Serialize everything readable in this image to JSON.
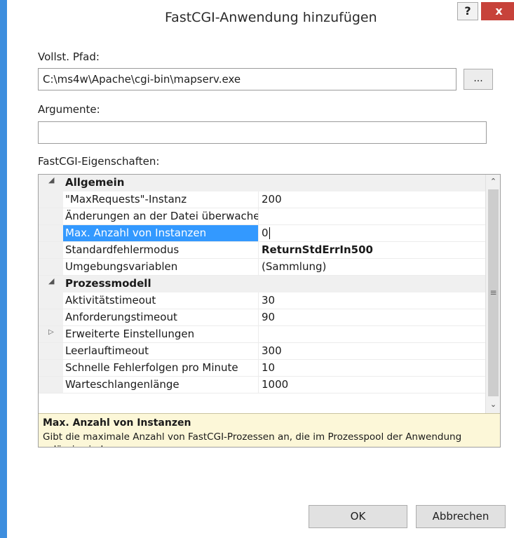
{
  "window": {
    "title": "FastCGI-Anwendung hinzufügen",
    "help_label": "?",
    "close_label": "x"
  },
  "full_path": {
    "label": "Vollst. Pfad:",
    "value": "C:\\ms4w\\Apache\\cgi-bin\\mapserv.exe",
    "browse_label": "..."
  },
  "arguments": {
    "label": "Argumente:",
    "value": ""
  },
  "properties": {
    "label": "FastCGI-Eigenschaften:",
    "categories": [
      {
        "name": "Allgemein",
        "expanded": true,
        "rows": [
          {
            "name": "\"MaxRequests\"-Instanz",
            "value": "200"
          },
          {
            "name": "Änderungen an der Datei überwache",
            "value": ""
          },
          {
            "name": "Max. Anzahl von Instanzen",
            "value": "0",
            "selected": true
          },
          {
            "name": "Standardfehlermodus",
            "value": "ReturnStdErrIn500"
          },
          {
            "name": "Umgebungsvariablen",
            "value": "(Sammlung)"
          }
        ]
      },
      {
        "name": "Prozessmodell",
        "expanded": true,
        "rows": [
          {
            "name": "Aktivitätstimeout",
            "value": "30"
          },
          {
            "name": "Anforderungstimeout",
            "value": "90"
          },
          {
            "name": "Erweiterte Einstellungen",
            "value": "",
            "collapsed": true
          },
          {
            "name": "Leerlauftimeout",
            "value": "300"
          },
          {
            "name": "Schnelle Fehlerfolgen pro Minute",
            "value": "10"
          },
          {
            "name": "Warteschlangenlänge",
            "value": "1000"
          }
        ]
      }
    ],
    "description": {
      "title": "Max. Anzahl von Instanzen",
      "text": "Gibt die maximale Anzahl von FastCGI-Prozessen an, die im Prozesspool der Anwendung zulässig sind."
    }
  },
  "buttons": {
    "ok": "OK",
    "cancel": "Abbrechen"
  },
  "colors": {
    "title_accent": "#3d8ede",
    "close_red": "#c7423a",
    "selection_blue": "#3399ff",
    "description_bg": "#fcf7d8"
  }
}
